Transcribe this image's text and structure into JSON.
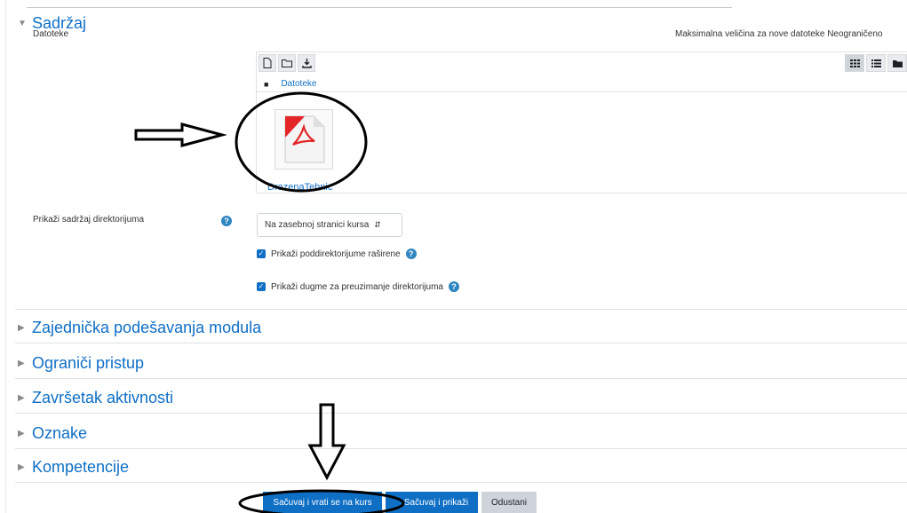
{
  "sections": {
    "content": {
      "title": "Sadržaj",
      "expanded": true
    },
    "collapsed": [
      {
        "title": "Zajednička podešavanja modula"
      },
      {
        "title": "Ograniči pristup"
      },
      {
        "title": "Završetak aktivnosti"
      },
      {
        "title": "Oznake"
      },
      {
        "title": "Kompetencije"
      }
    ]
  },
  "files": {
    "label": "Datoteke",
    "max_size": "Maksimalna veličina za nove datoteke Neograničeno",
    "path_label": "Datoteke",
    "file_name": "DrazenaTehnic",
    "file_icon": "pdf-icon",
    "toolbar_icons": [
      "add-file-icon",
      "create-folder-icon",
      "download-all-icon"
    ],
    "view_icons": [
      "icon-view-icon",
      "list-view-icon",
      "tree-view-icon"
    ]
  },
  "display": {
    "label": "Prikaži sadržaj direktorijuma",
    "select_value": "Na zasebnoj stranici kursa"
  },
  "options": {
    "expand_subfolders": {
      "label": "Prikaži poddirektorijume raširene",
      "checked": true
    },
    "show_download": {
      "label": "Prikaži dugme za preuzimanje direktorijuma",
      "checked": true
    }
  },
  "buttons": {
    "save_return": "Sačuvaj i vrati se na kurs",
    "save_display": "Sačuvaj i prikaži",
    "cancel": "Odustani"
  },
  "colors": {
    "accent": "#0f6fc5",
    "annotation": "#000000"
  }
}
